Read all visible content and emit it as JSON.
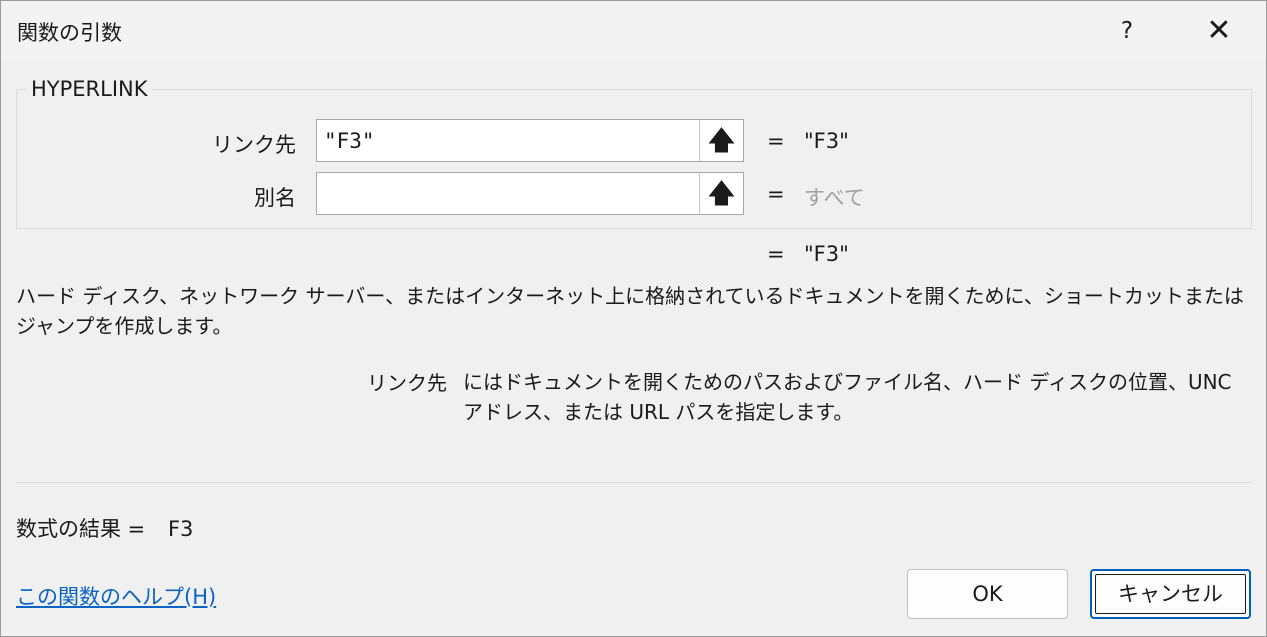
{
  "window": {
    "title": "関数の引数",
    "help_glyph": "?",
    "close_glyph": "✕"
  },
  "function": {
    "name": "HYPERLINK",
    "args": [
      {
        "label": "リンク先",
        "value": "\"F3\"",
        "result": "\"F3\"",
        "button_icon": "collapse-dialog-icon",
        "button_glyph": "🡅"
      },
      {
        "label": "別名",
        "value": "",
        "result": "すべて",
        "button_icon": "collapse-dialog-icon",
        "button_glyph": "🡅"
      }
    ],
    "equals": "=",
    "overall_result": "\"F3\""
  },
  "description": "ハード ディスク、ネットワーク サーバー、またはインターネット上に格納されているドキュメントを開くために、ショートカットまたはジャンプを作成します。",
  "arg_help": {
    "name": "リンク先",
    "text": "にはドキュメントを開くためのパスおよびファイル名、ハード ディスクの位置、UNC アドレス、または URL パスを指定します。"
  },
  "formula_result": {
    "label": "数式の結果 =",
    "value": "F3"
  },
  "footer": {
    "help_link": "この関数のヘルプ(H)",
    "ok_label": "OK",
    "cancel_label": "キャンセル"
  },
  "colors": {
    "link": "#0b63c4",
    "focus_border": "#005fb8",
    "placeholder_result": "#a0a0a0"
  }
}
